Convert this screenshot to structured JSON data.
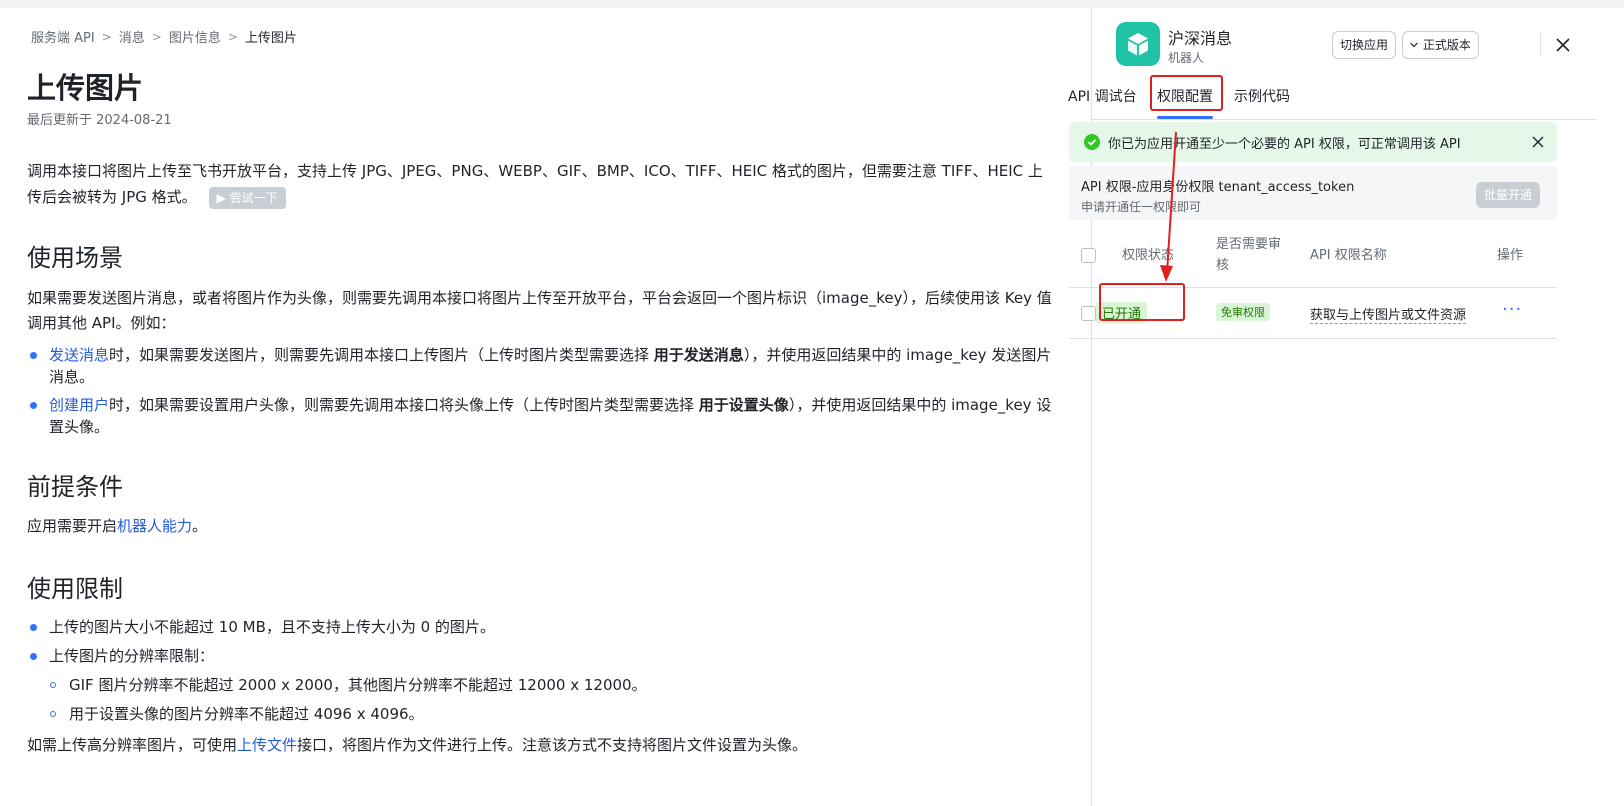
{
  "breadcrumb": [
    "服务端 API",
    "消息",
    "图片信息",
    "上传图片"
  ],
  "doc": {
    "title": "上传图片",
    "updated": "最后更新于 2024-08-21",
    "intro": "调用本接口将图片上传至飞书开放平台，支持上传 JPG、JPEG、PNG、WEBP、GIF、BMP、ICO、TIFF、HEIC 格式的图片，但需要注意 TIFF、HEIC 上传后会被转为 JPG 格式。",
    "try_button": "▶ 尝试一下",
    "section_usage": "使用场景",
    "usage_para": "如果需要发送图片消息，或者将图片作为头像，则需要先调用本接口将图片上传至开放平台，平台会返回一个图片标识（image_key），后续使用该 Key 值调用其他 API。例如：",
    "usage_items": [
      {
        "link": "发送消息",
        "pre": "时，如果需要发送图片，则需要先调用本接口上传图片（上传时图片类型需要选择 ",
        "bold": "用于发送消息",
        "post": "），并使用返回结果中的 image_key 发送图片消息。"
      },
      {
        "link": "创建用户",
        "pre": "时，如果需要设置用户头像，则需要先调用本接口将头像上传（上传时图片类型需要选择 ",
        "bold": "用于设置头像",
        "post": "），并使用返回结果中的 image_key 设置头像。"
      }
    ],
    "section_prereq": "前提条件",
    "prereq_pre": "应用需要开启",
    "prereq_link": "机器人能力",
    "prereq_post": "。",
    "section_limits": "使用限制",
    "limits": [
      "上传的图片大小不能超过 10 MB，且不支持上传大小为 0 的图片。",
      "上传图片的分辨率限制："
    ],
    "sub_limits": [
      "GIF 图片分辨率不能超过 2000 x 2000，其他图片分辨率不能超过 12000 x 12000。",
      "用于设置头像的图片分辨率不能超过 4096 x 4096。"
    ],
    "last_pre": "如需上传高分辨率图片，可使用",
    "last_link": "上传文件",
    "last_post": "接口，将图片作为文件进行上传。注意该方式不支持将图片文件设置为头像。"
  },
  "panel": {
    "app_name": "沪深消息",
    "app_sub": "机器人",
    "switch_app": "切换应用",
    "version": "正式版本",
    "tabs": [
      "API 调试台",
      "权限配置",
      "示例代码"
    ],
    "active_tab": "权限配置",
    "notice": "你已为应用开通至少一个必要的 API 权限，可正常调用该 API",
    "perm_title": "API 权限-应用身份权限 tenant_access_token",
    "perm_sub": "申请开通任一权限即可",
    "batch_button": "批量开通",
    "columns": {
      "status": "权限状态",
      "review": "是否需要审核",
      "name": "API 权限名称",
      "action": "操作"
    },
    "row": {
      "status": "已开通",
      "review": "免审权限",
      "name": "获取与上传图片或文件资源",
      "action": "···"
    }
  },
  "colors": {
    "accent": "#3370ff",
    "link": "#245bdb",
    "success_bg": "#e4f7e8",
    "highlight": "#e02020",
    "app_logo": "#21c3a6"
  }
}
